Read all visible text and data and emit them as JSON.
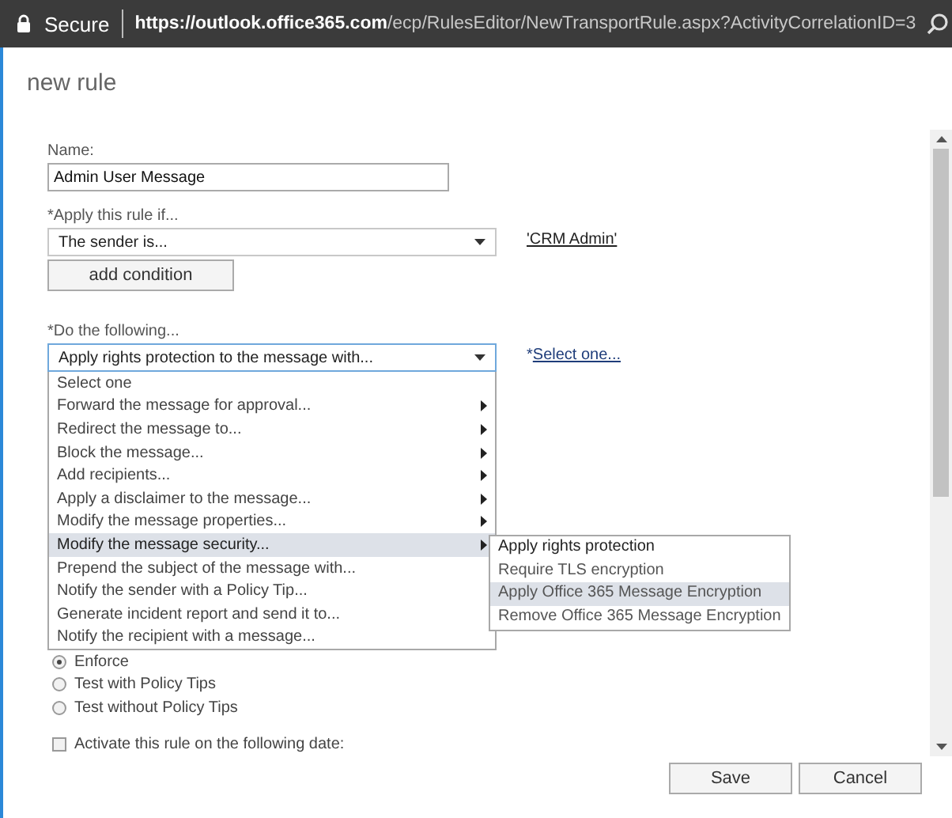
{
  "address_bar": {
    "security": "Secure",
    "url_host": "https://outlook.office365.com",
    "url_path": "/ecp/RulesEditor/NewTransportRule.aspx?ActivityCorrelationID=3"
  },
  "title": "new rule",
  "name_field": {
    "label": "Name:",
    "value": "Admin User Message"
  },
  "condition": {
    "label": "*Apply this rule if...",
    "value": "The sender is...",
    "link": "'CRM Admin'"
  },
  "add_condition_button": "add condition",
  "action": {
    "label": "*Do the following...",
    "value": "Apply rights protection to the message with...",
    "link_prefix": "*",
    "link": "Select one...",
    "expanded": true
  },
  "action_menu": [
    {
      "label": "Select one",
      "has_submenu": false,
      "selected": false
    },
    {
      "label": "Forward the message for approval...",
      "has_submenu": true,
      "selected": false
    },
    {
      "label": "Redirect the message to...",
      "has_submenu": true,
      "selected": false
    },
    {
      "label": "Block the message...",
      "has_submenu": true,
      "selected": false
    },
    {
      "label": "Add recipients...",
      "has_submenu": true,
      "selected": false
    },
    {
      "label": "Apply a disclaimer to the message...",
      "has_submenu": true,
      "selected": false
    },
    {
      "label": "Modify the message properties...",
      "has_submenu": true,
      "selected": false
    },
    {
      "label": "Modify the message security...",
      "has_submenu": true,
      "selected": true
    },
    {
      "label": "Prepend the subject of the message with...",
      "has_submenu": false,
      "selected": false
    },
    {
      "label": "Notify the sender with a Policy Tip...",
      "has_submenu": false,
      "selected": false
    },
    {
      "label": "Generate incident report and send it to...",
      "has_submenu": false,
      "selected": false
    },
    {
      "label": "Notify the recipient with a message...",
      "has_submenu": false,
      "selected": false
    }
  ],
  "submenu": [
    {
      "label": "Apply rights protection",
      "selected": false
    },
    {
      "label": "Require TLS encryption",
      "selected": false
    },
    {
      "label": "Apply Office 365 Message Encryption",
      "selected": true
    },
    {
      "label": "Remove Office 365 Message Encryption",
      "selected": false
    }
  ],
  "mode_options": [
    {
      "label": "Enforce",
      "selected": true
    },
    {
      "label": "Test with Policy Tips",
      "selected": false
    },
    {
      "label": "Test without Policy Tips",
      "selected": false
    }
  ],
  "activate_date": {
    "label": "Activate this rule on the following date:",
    "checked": false
  },
  "buttons": [
    "Save",
    "Cancel"
  ]
}
